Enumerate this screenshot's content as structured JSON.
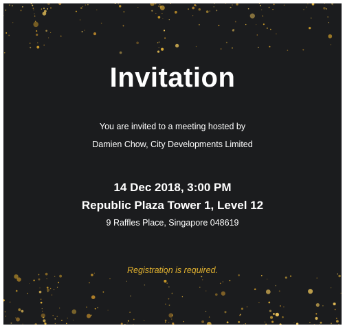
{
  "invitation": {
    "title": "Invitation",
    "intro_line1": "You are invited to a meeting hosted by",
    "intro_line2": "Damien Chow, City Developments Limited",
    "date_time": "14 Dec 2018, 3:00 PM",
    "venue": "Republic Plaza Tower 1, Level 12",
    "address": "9 Raffles Place, Singapore 048619",
    "note": "Registration is required."
  },
  "colors": {
    "background": "#1b1c1e",
    "text": "#ffffff",
    "accent_gold": "#e2b22f"
  },
  "decoration": {
    "sparkle_style": "scattered-gold-confetti"
  }
}
